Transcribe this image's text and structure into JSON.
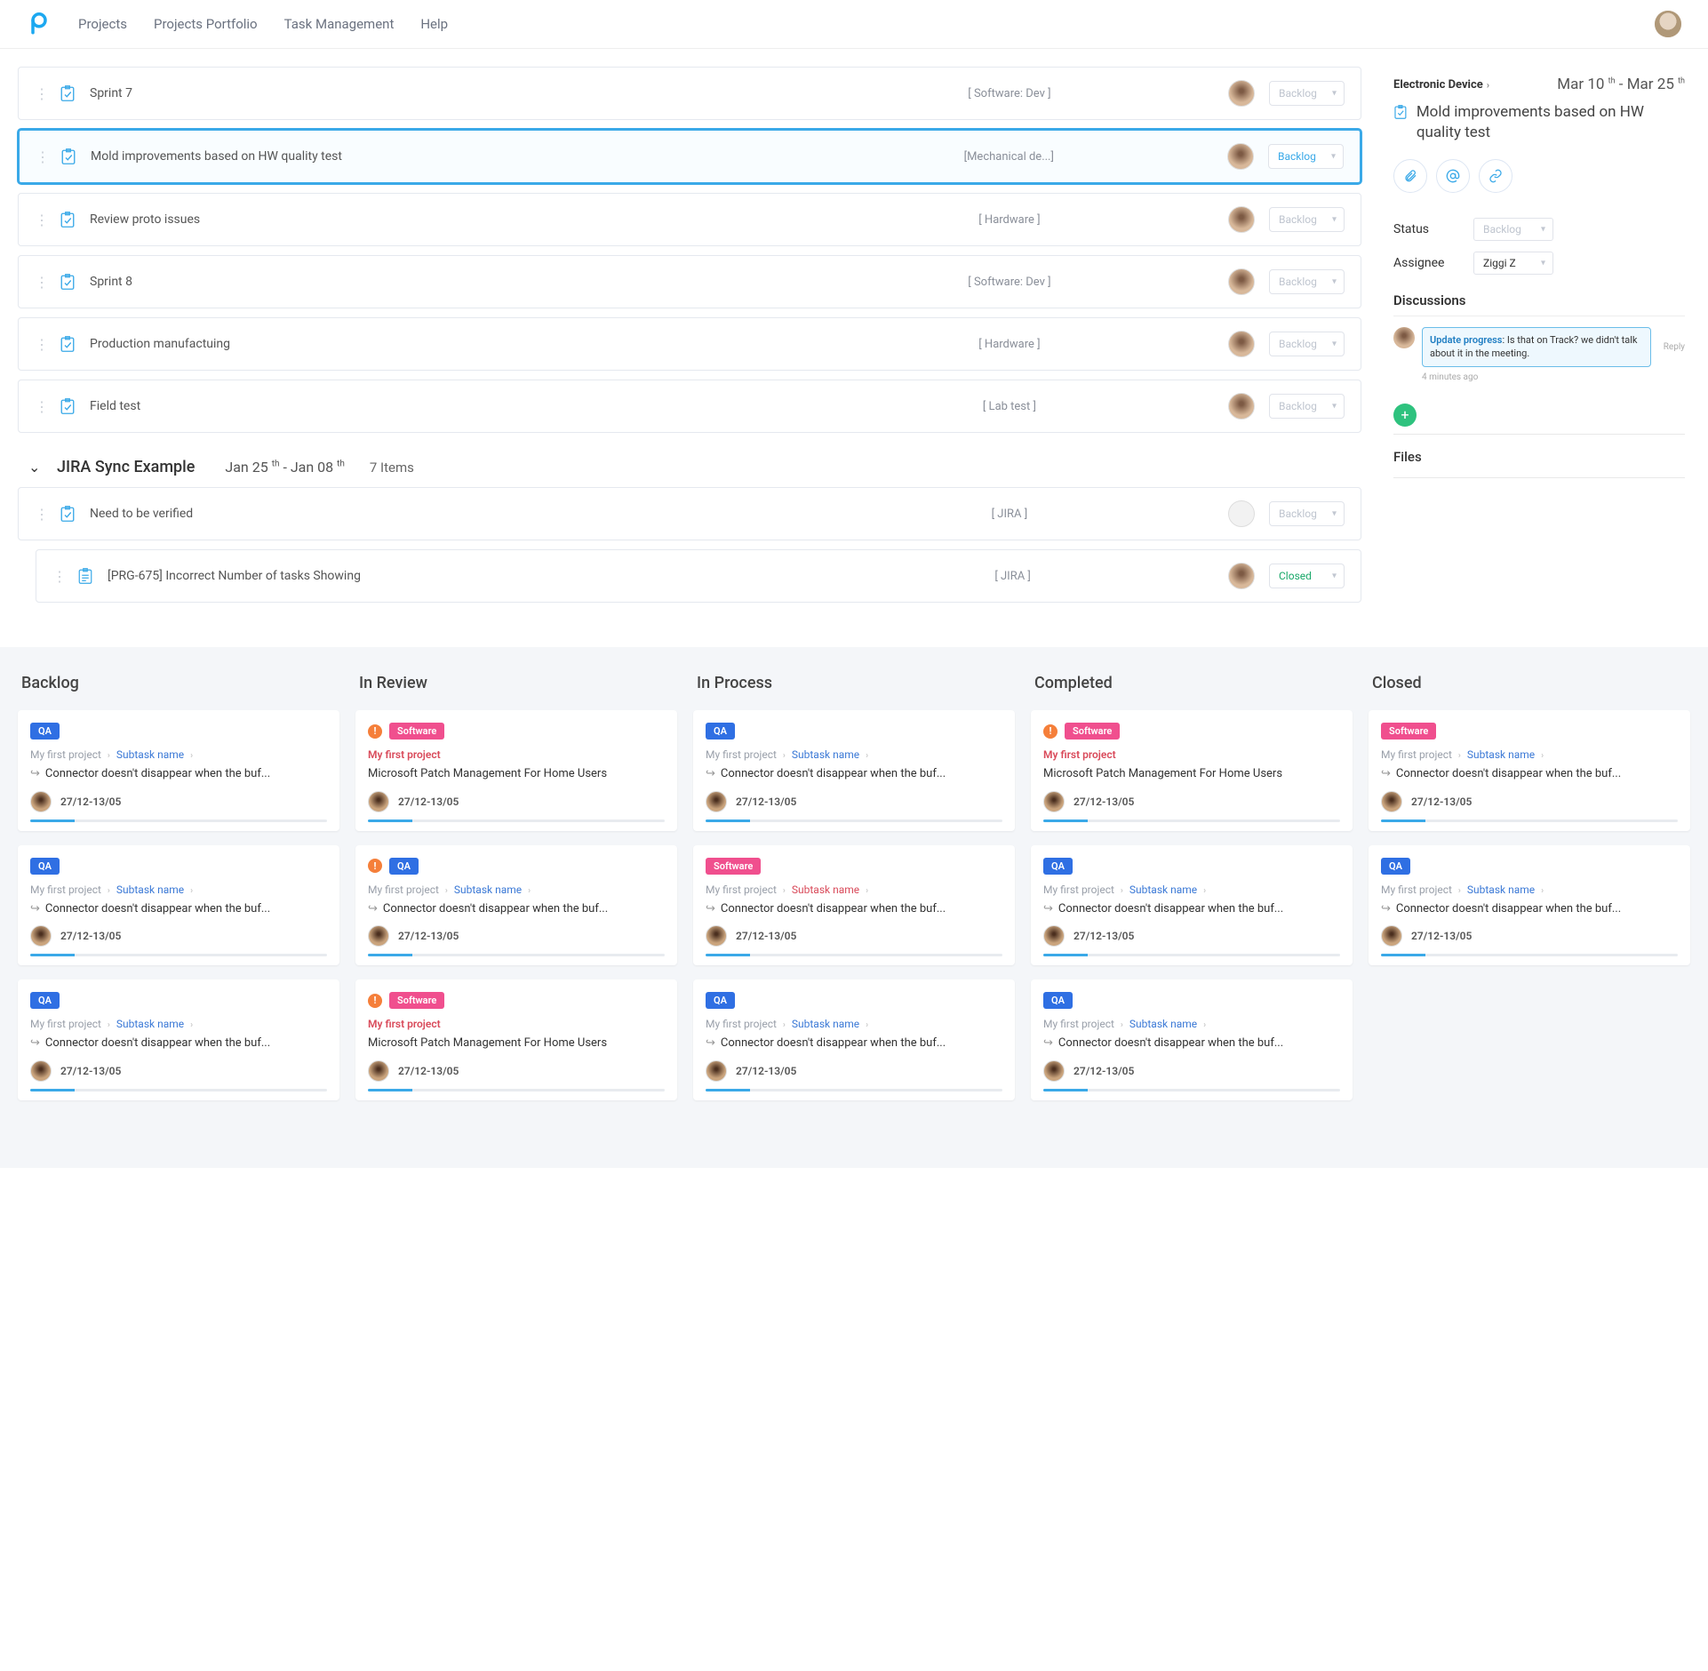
{
  "nav": {
    "projects": "Projects",
    "portfolio": "Projects Portfolio",
    "task_mgmt": "Task Management",
    "help": "Help"
  },
  "tasks": [
    {
      "title": "Sprint 7",
      "category": "[ Software: Dev ]",
      "status": "Backlog"
    },
    {
      "title": "Mold improvements based on HW quality test",
      "category": "[Mechanical de...]",
      "status": "Backlog"
    },
    {
      "title": "Review proto issues",
      "category": "[ Hardware ]",
      "status": "Backlog"
    },
    {
      "title": "Sprint 8",
      "category": "[ Software: Dev ]",
      "status": "Backlog"
    },
    {
      "title": "Production manufactuing",
      "category": "[ Hardware ]",
      "status": "Backlog"
    },
    {
      "title": "Field test",
      "category": "[ Lab test ]",
      "status": "Backlog"
    }
  ],
  "group": {
    "title": "JIRA Sync Example",
    "date_a": "Jan 25",
    "date_a_sup": "th",
    "date_sep": "- Jan 08",
    "date_b_sup": "th",
    "count": "7 Items"
  },
  "group_tasks": [
    {
      "title": "Need to be verified",
      "category": "[ JIRA ]",
      "status": "Backlog"
    },
    {
      "title": "[PRG-675] Incorrect Number of tasks Showing",
      "category": "[ JIRA ]",
      "status": "Closed"
    }
  ],
  "panel": {
    "crumb": "Electronic Device",
    "date_a": "Mar 10",
    "date_a_sup": "th",
    "date_sep": "- Mar 25",
    "date_b_sup": "th",
    "title": "Mold improvements based on HW quality test",
    "status_label": "Status",
    "status_value": "Backlog",
    "assignee_label": "Assignee",
    "assignee_value": "Ziggi Z",
    "disc_heading": "Discussions",
    "disc_lead": "Update progress",
    "disc_body": ": Is that on Track? we didn't talk about it in the meeting.",
    "reply": "Reply",
    "disc_time": "4 minutes ago",
    "files": "Files"
  },
  "kanban": {
    "columns": [
      "Backlog",
      "In Review",
      "In Process",
      "Completed",
      "Closed"
    ],
    "labels": {
      "qa": "QA",
      "soft": "Software",
      "proj": "My first project",
      "sub": "Subtask name",
      "conn": "Connector doesn't disappear when the buf...",
      "ms": "Microsoft Patch Management For Home Users",
      "date": "27/12-13/05"
    },
    "grid": [
      [
        {
          "b": "qa",
          "t": "conn"
        },
        {
          "alert": true,
          "b": "soft",
          "proj_red": true,
          "t": "ms"
        },
        {
          "b": "qa",
          "t": "conn"
        },
        {
          "alert": true,
          "b": "soft",
          "proj_red": true,
          "t": "ms"
        },
        {
          "b": "soft",
          "t": "conn"
        }
      ],
      [
        {
          "b": "qa",
          "t": "conn"
        },
        {
          "alert": true,
          "b": "qa",
          "t": "conn"
        },
        {
          "b": "soft",
          "sub_red": true,
          "t": "conn"
        },
        {
          "b": "qa",
          "t": "conn"
        },
        {
          "b": "qa",
          "t": "conn"
        }
      ],
      [
        {
          "b": "qa",
          "t": "conn"
        },
        {
          "alert": true,
          "b": "soft",
          "proj_red": true,
          "t": "ms"
        },
        {
          "b": "qa",
          "t": "conn"
        },
        {
          "b": "qa",
          "t": "conn"
        },
        null
      ]
    ]
  }
}
